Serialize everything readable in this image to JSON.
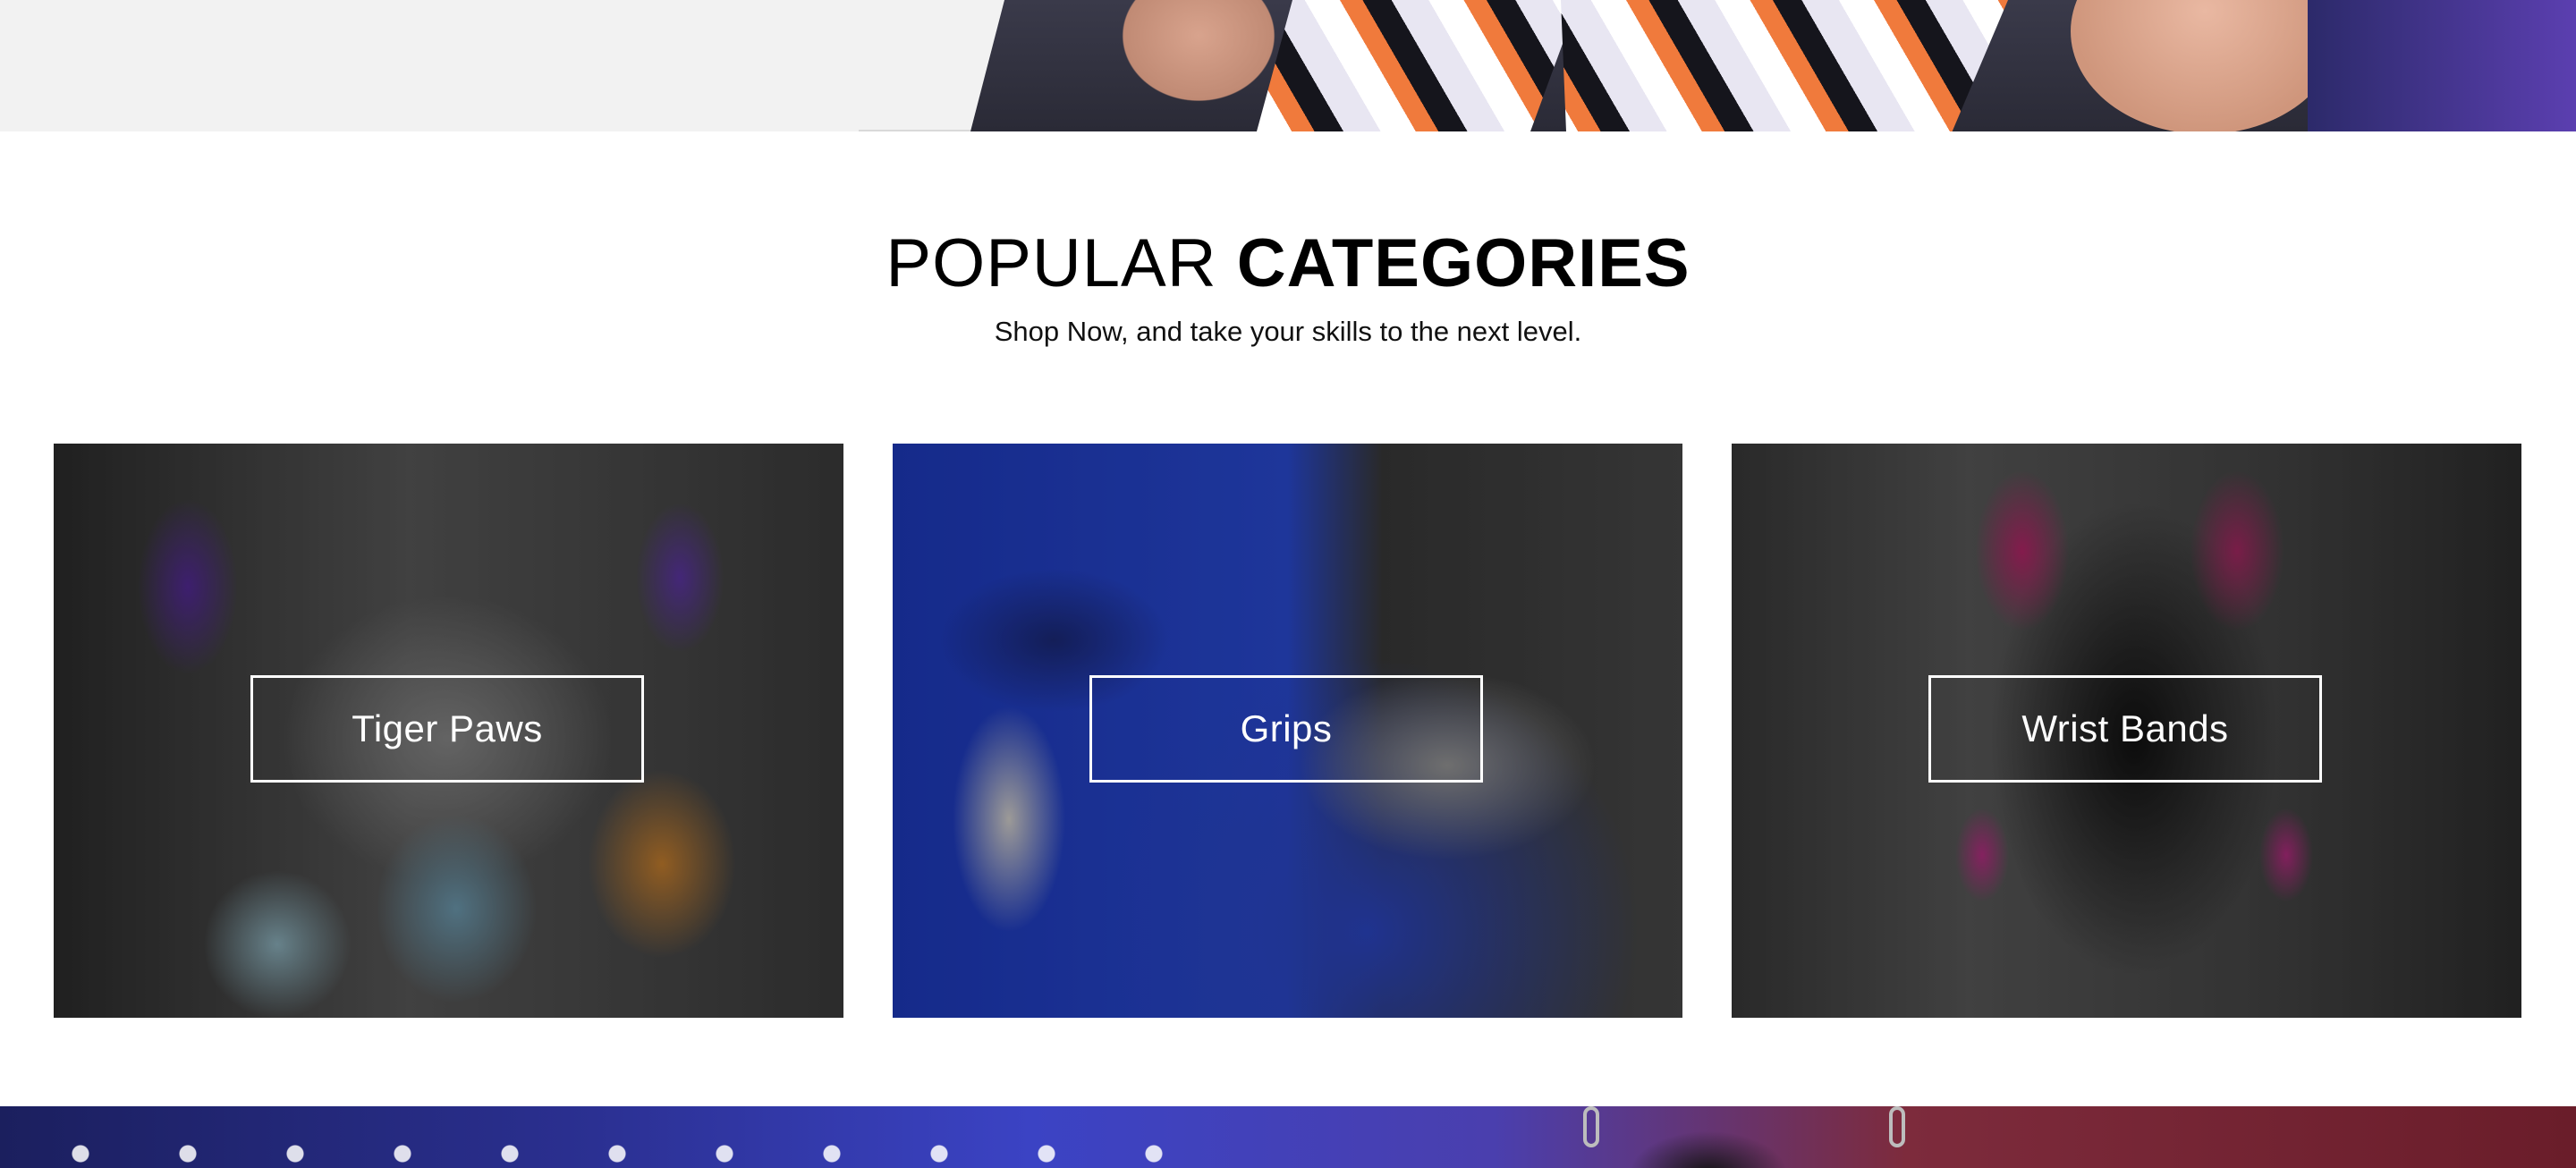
{
  "section": {
    "title_light": "POPULAR",
    "title_bold": "CATEGORIES",
    "subtitle": "Shop Now, and take your skills to the next level."
  },
  "categories": [
    {
      "label": "Tiger Paws"
    },
    {
      "label": "Grips"
    },
    {
      "label": "Wrist Bands"
    }
  ],
  "colors": {
    "overlay_text": "#ffffff",
    "heading": "#000000",
    "top_band": "#f2f2f2"
  }
}
